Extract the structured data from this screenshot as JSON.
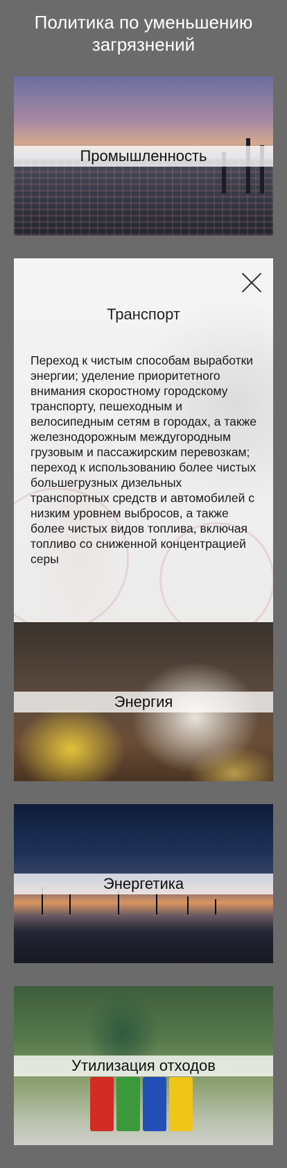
{
  "page": {
    "title": "Политика по уменьшению загрязнений"
  },
  "cards": [
    {
      "label": "Промышленность"
    },
    {
      "label": "Транспорт",
      "expanded": true,
      "body": "Переход к чистым способам выработки энергии; уделение приоритетного внимания скоростному городскому транспорту, пешеходным и велосипедным сетям в городах, а также железнодорожным междугородным грузовым и пассажирским перевозкам; переход к использованию более чистых большегрузных дизельных транспортных средств и автомобилей с низким уровнем выбросов, а также более чистых видов топлива, включая топливо со сниженной концентрацией серы"
    },
    {
      "label": "Энергия"
    },
    {
      "label": "Энергетика"
    },
    {
      "label": "Утилизация отходов"
    }
  ],
  "icons": {
    "close": "close-icon"
  },
  "colors": {
    "background": "#6b6b6b",
    "label_band": "#ffffff"
  }
}
